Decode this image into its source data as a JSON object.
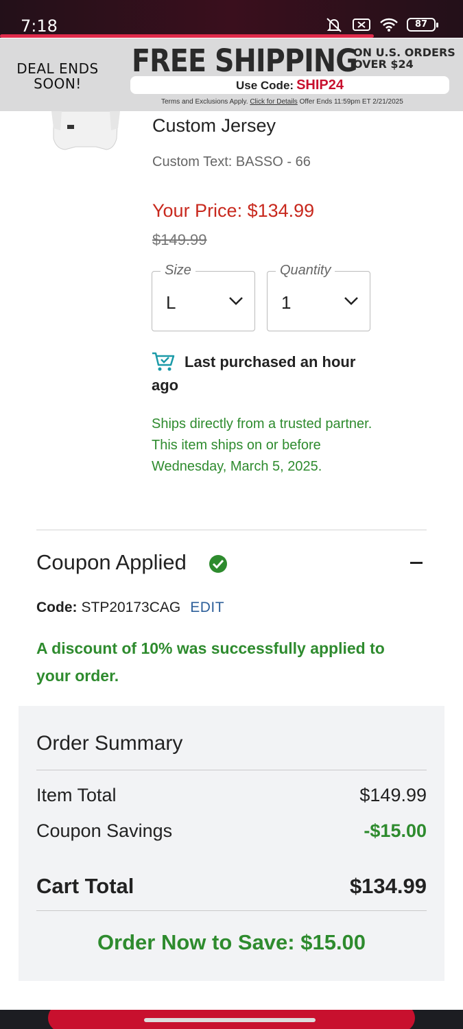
{
  "status_bar": {
    "time": "7:18",
    "battery": "87",
    "icons": [
      "mute-icon",
      "no-data-icon",
      "wifi-icon",
      "battery-icon"
    ]
  },
  "promo": {
    "deal_ends": "DEAL ENDS SOON!",
    "headline": "FREE SHIPPING",
    "subline_1": "ON U.S. ORDERS",
    "subline_2": "OVER $24",
    "use_code_label": "Use Code:",
    "code": "SHIP24",
    "terms_prefix": "Terms and Exclusions Apply.",
    "terms_link": "Click for Details",
    "terms_suffix": "Offer Ends 11:59pm ET 2/21/2025"
  },
  "product": {
    "title": "Custom Jersey",
    "custom_text": "Custom Text: BASSO - 66",
    "your_price": "Your Price: $134.99",
    "original_price": "$149.99",
    "size_label": "Size",
    "size_value": "L",
    "quantity_label": "Quantity",
    "quantity_value": "1",
    "last_purchased": "Last purchased an hour ago",
    "ships_note": "Ships directly from a trusted partner. This item ships on or before Wednesday, March 5, 2025."
  },
  "coupon": {
    "title": "Coupon Applied",
    "code_label": "Code:",
    "code_value": "STP20173CAG",
    "edit_label": "EDIT",
    "message": "A discount of 10% was successfully applied to your order."
  },
  "summary": {
    "title": "Order Summary",
    "item_total_label": "Item Total",
    "item_total_value": "$149.99",
    "coupon_savings_label": "Coupon Savings",
    "coupon_savings_value": "-$15.00",
    "cart_total_label": "Cart Total",
    "cart_total_value": "$134.99",
    "order_now": "Order Now to Save: $15.00"
  },
  "colors": {
    "accent_red": "#c8102e",
    "price_red": "#c8291e",
    "success_green": "#2e8b2e",
    "link_blue": "#2d5f9a"
  }
}
